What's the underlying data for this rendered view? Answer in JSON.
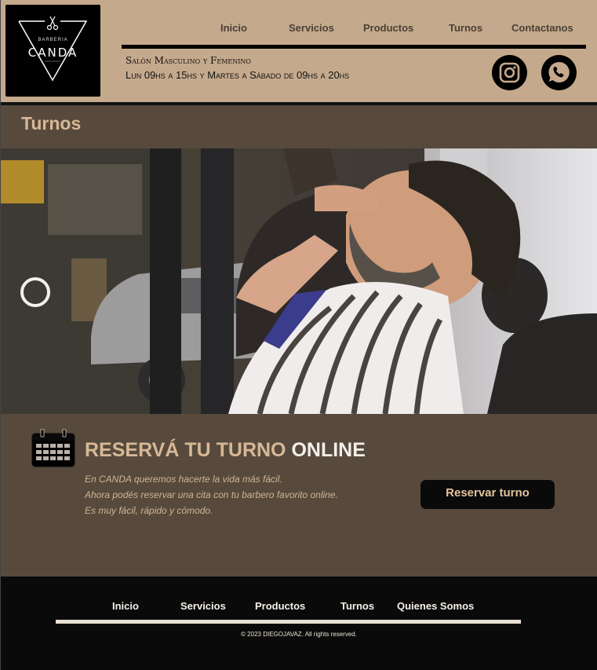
{
  "logo": {
    "small": "BARBERIA",
    "big": "CANDA"
  },
  "nav": [
    {
      "label": "Inicio"
    },
    {
      "label": "Servicios"
    },
    {
      "label": "Productos"
    },
    {
      "label": "Turnos"
    },
    {
      "label": "Contactanos"
    }
  ],
  "info": {
    "line1": "Salón Masculino y Femenino",
    "line2": "Lun 09hs a 15hs y Martes a Sábado de 09hs a 20hs"
  },
  "social": {
    "instagram": "instagram-icon",
    "whatsapp": "whatsapp-icon"
  },
  "page_title": "Turnos",
  "booking": {
    "title_a": "RESERVÁ TU TURNO",
    "title_b": "ONLINE",
    "lines": [
      "En CANDA queremos hacerte la vida más fácil.",
      "Ahora podés reservar una cita con tu barbero favorito online.",
      "Es muy fácil, rápido y cómodo."
    ],
    "button": "Reservar turno"
  },
  "footer": {
    "nav": [
      {
        "label": "Inicio"
      },
      {
        "label": "Servicios"
      },
      {
        "label": "Productos"
      },
      {
        "label": "Turnos"
      },
      {
        "label": "Quienes Somos"
      }
    ],
    "copyright": "© 2023 DIEGOJAVAZ.  All rights reserved."
  },
  "colors": {
    "header_bg": "#c5a98c",
    "band_bg": "#574a3d",
    "accent": "#d7b896",
    "footer_bg": "#0a0a0a"
  }
}
